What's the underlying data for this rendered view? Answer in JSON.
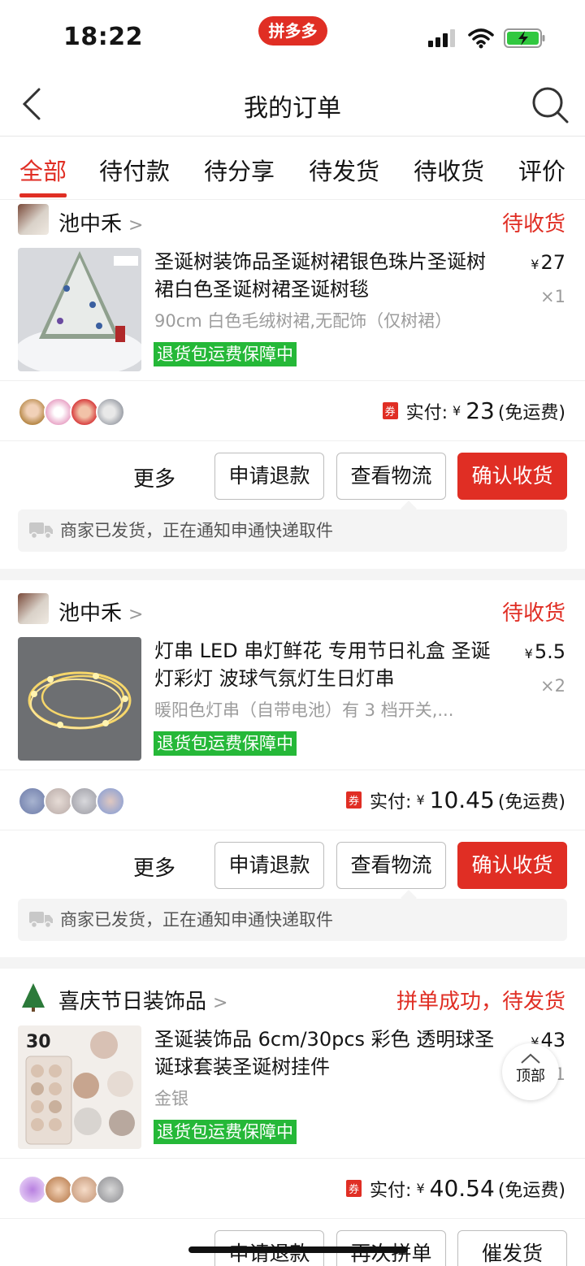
{
  "status_bar": {
    "time": "18:22",
    "app_pill": "拼多多"
  },
  "nav": {
    "title": "我的订单"
  },
  "tabs": [
    "全部",
    "待付款",
    "待分享",
    "待发货",
    "待收货",
    "评价"
  ],
  "orders": [
    {
      "shop_name": "池中禾",
      "status": "待收货",
      "title": "圣诞树装饰品圣诞树裙银色珠片圣诞树裙白色圣诞树裙圣诞树毯",
      "spec": "90cm 白色毛绒树裙,无配饰（仅树裙）",
      "tag": "退货包运费保障中",
      "price_symbol": "¥",
      "price": "27",
      "qty": "×1",
      "coupon": "券",
      "paid_label": "实付:",
      "paid_symbol": "¥",
      "paid_amount": "23",
      "shipping": "(免运费)",
      "actions": {
        "more": "更多",
        "refund": "申请退款",
        "logistics": "查看物流",
        "confirm": "确认收货"
      },
      "notice": "商家已发货，正在通知申通快递取件"
    },
    {
      "shop_name": "池中禾",
      "status": "待收货",
      "title": "灯串 LED 串灯鲜花 专用节日礼盒 圣诞灯彩灯 波球气氛灯生日灯串",
      "spec": "暖阳色灯串（自带电池）有 3 档开关,...",
      "tag": "退货包运费保障中",
      "price_symbol": "¥",
      "price": "5.5",
      "qty": "×2",
      "coupon": "券",
      "paid_label": "实付:",
      "paid_symbol": "¥",
      "paid_amount": "10.45",
      "shipping": "(免运费)",
      "actions": {
        "more": "更多",
        "refund": "申请退款",
        "logistics": "查看物流",
        "confirm": "确认收货"
      },
      "notice": "商家已发货，正在通知申通快递取件"
    },
    {
      "shop_name": "喜庆节日装饰品",
      "status": "拼单成功，待发货",
      "title": "圣诞装饰品 6cm/30pcs 彩色 透明球圣诞球套装圣诞树挂件",
      "spec": "金银",
      "tag": "退货包运费保障中",
      "thumb_label": "30",
      "price_symbol": "¥",
      "price": "43",
      "qty": "1",
      "coupon": "券",
      "paid_label": "实付:",
      "paid_symbol": "¥",
      "paid_amount": "40.54",
      "shipping": "(免运费)",
      "actions": {
        "refund": "申请退款",
        "regroup": "再次拼单",
        "urge": "催发货"
      }
    }
  ],
  "back_to_top": "顶部",
  "colors": {
    "accent": "#e02e24",
    "tag_green": "#25b838"
  }
}
